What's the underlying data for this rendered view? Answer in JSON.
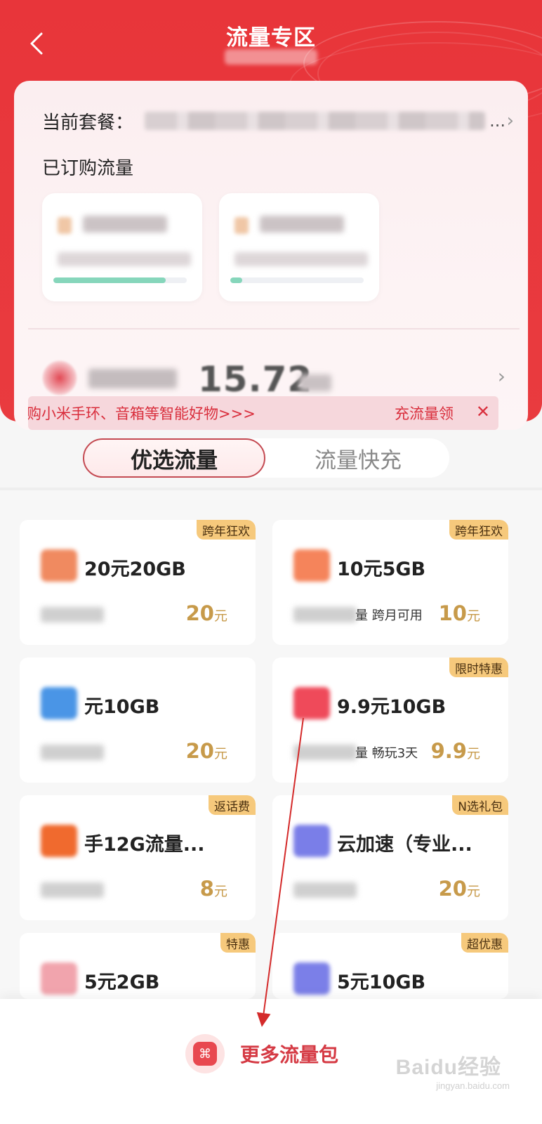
{
  "header": {
    "title": "流量专区"
  },
  "plan": {
    "label": "当前套餐：",
    "ellipsis": "..."
  },
  "subscribed": {
    "title": "已订购流量",
    "cards": [
      {
        "progress": 0.84,
        "bar_color": "#86d6bb"
      },
      {
        "progress": 0.09,
        "bar_color": "#86d6bb"
      }
    ]
  },
  "balance": {
    "value": "15.72"
  },
  "promo": {
    "text": "购小米手环、音箱等智能好物>>>",
    "text2": "充流量领",
    "close": "✕"
  },
  "tabs": [
    {
      "label": "优选流量",
      "active": true
    },
    {
      "label": "流量快充",
      "active": false
    }
  ],
  "products": [
    {
      "tag": "跨年狂欢",
      "title": "20元20GB",
      "desc": "",
      "price": "20",
      "unit": "元",
      "icon_color": "#f08a60"
    },
    {
      "tag": "跨年狂欢",
      "title": "10元5GB",
      "desc": "量 跨月可用",
      "price": "10",
      "unit": "元",
      "icon_color": "#f5845b"
    },
    {
      "tag": "",
      "title": "元10GB",
      "desc": "",
      "price": "20",
      "unit": "元",
      "icon_color": "#4a95e6"
    },
    {
      "tag": "限时特惠",
      "title": "9.9元10GB",
      "desc": "量 畅玩3天",
      "price": "9.9",
      "unit": "元",
      "icon_color": "#ef4a5a"
    },
    {
      "tag": "返话费",
      "title": "手12G流量...",
      "desc": "",
      "price": "8",
      "unit": "元",
      "icon_color": "#f06a2e"
    },
    {
      "tag": "N选礼包",
      "title": "云加速（专业...",
      "desc": "",
      "price": "20",
      "unit": "元",
      "icon_color": "#7a7ee8"
    },
    {
      "tag": "特惠",
      "title": "5元2GB",
      "desc": "",
      "price": "",
      "unit": "",
      "icon_color": "#f1a4ad"
    },
    {
      "tag": "超优惠",
      "title": "5元10GB",
      "desc": "",
      "price": "",
      "unit": "",
      "icon_color": "#7b7fe8"
    }
  ],
  "bottom": {
    "more_label": "更多流量包",
    "icon_glyph": "⌘"
  },
  "watermark": {
    "brand": "Baidu经验",
    "url": "jingyan.baidu.com"
  },
  "colors": {
    "brand_red": "#e8353a",
    "price_gold": "#c79a4a",
    "tag_bg": "#f6c97c"
  }
}
